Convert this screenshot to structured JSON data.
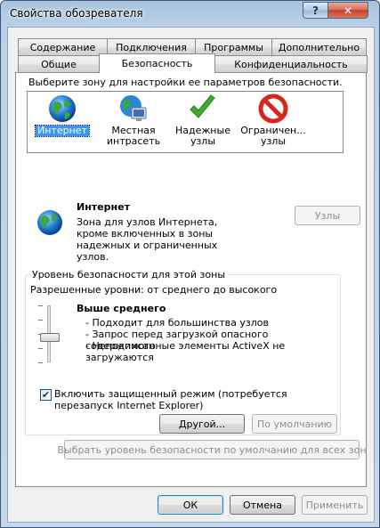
{
  "window": {
    "title": "Свойства обозревателя",
    "help_glyph": "?",
    "close_glyph": "✕"
  },
  "tabs_back": [
    "Содержание",
    "Подключения",
    "Программы",
    "Дополнительно"
  ],
  "tabs_front": [
    "Общие",
    "Безопасность",
    "Конфиденциальность"
  ],
  "active_tab": "Безопасность",
  "security": {
    "zone_prompt": "Выберите зону для настройки ее параметров безопасности.",
    "zones": [
      {
        "label": "Интернет",
        "icon": "globe-icon",
        "selected": true
      },
      {
        "label": "Местная интрасеть",
        "icon": "intranet-icon",
        "selected": false
      },
      {
        "label": "Надежные узлы",
        "icon": "checkmark-icon",
        "selected": false
      },
      {
        "label": "Ограничен... узлы",
        "icon": "restricted-icon",
        "selected": false
      }
    ],
    "zone_title": "Интернет",
    "zone_description": "Зона для узлов Интернета, кроме включенных в зоны надежных и ограниченных узлов.",
    "sites_button": "Узлы",
    "level_group_title": "Уровень безопасности для этой зоны",
    "allowed_levels": "Разрешенные уровни: от среднего до высокого",
    "level_name": "Выше среднего",
    "level_details": [
      "- Подходит для большинства узлов",
      "- Запрос перед загрузкой опасного содержимого",
      "- Неподписанные элементы ActiveX не загружаются"
    ],
    "protected_mode_label": "Включить защищенный режим (потребуется перезапуск Internet Explorer)",
    "protected_mode_checked": true,
    "custom_button": "Другой...",
    "default_button": "По умолчанию",
    "reset_all_button": "Выбрать уровень безопасности по умолчанию для всех зон"
  },
  "footer": {
    "ok": "ОК",
    "cancel": "Отмена",
    "apply": "Применить"
  },
  "colors": {
    "selection": "#3399ff",
    "restricted_red": "#d8261c",
    "trusted_green": "#3cae2a"
  }
}
